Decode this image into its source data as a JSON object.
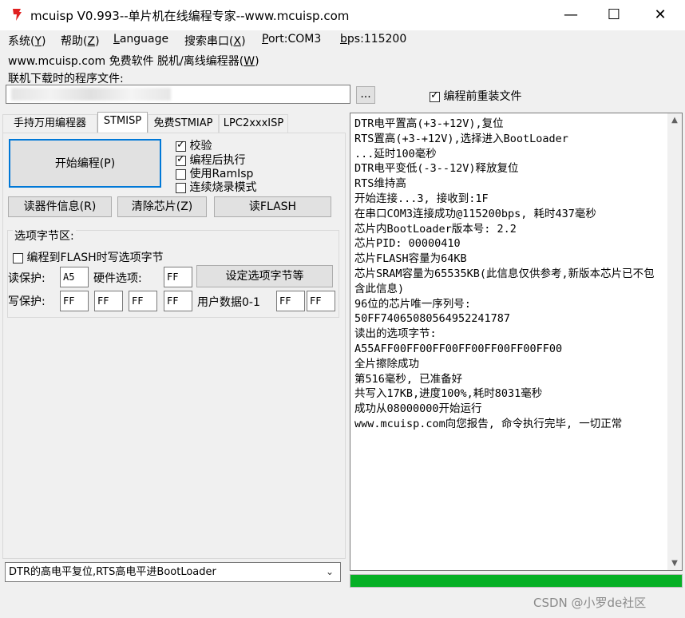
{
  "window": {
    "title": "mcuisp V0.993--单片机在线编程专家--www.mcuisp.com",
    "minimize": "—",
    "maximize": "☐",
    "close": "✕"
  },
  "menu": [
    {
      "text": "系统(",
      "key": "Y",
      "end": ")"
    },
    {
      "text": "帮助(",
      "key": "Z",
      "end": ")"
    },
    {
      "text": "",
      "key": "L",
      "end": "anguage"
    },
    {
      "text": "搜索串口(",
      "key": "X",
      "end": ")"
    },
    {
      "text": "",
      "key": "P",
      "end": "ort:COM3"
    },
    {
      "text": "",
      "key": "b",
      "end": "ps:115200"
    }
  ],
  "line2": {
    "text": "www.mcuisp.com 免费软件 脱机/离线编程器(",
    "key": "W",
    "end": ")"
  },
  "file": {
    "label": "联机下载时的程序文件:",
    "browse": "...",
    "reload_label": "编程前重装文件",
    "reload_checked": true
  },
  "tabs": [
    "手持万用编程器",
    "STMISP",
    "免费STMIAP",
    "LPC2xxxISP"
  ],
  "active_tab": 1,
  "stmisp": {
    "start_button": "开始编程(P)",
    "options": [
      {
        "label": "校验",
        "checked": true
      },
      {
        "label": "编程后执行",
        "checked": true
      },
      {
        "label": "使用RamIsp",
        "checked": false
      },
      {
        "label": "连续烧录模式",
        "checked": false
      }
    ],
    "read_info_button": "读器件信息(R)",
    "erase_button": "清除芯片(Z)",
    "read_flash_button": "读FLASH",
    "option_bytes": {
      "title": "选项字节区:",
      "write_when_flash_label": "编程到FLASH时写选项字节",
      "write_when_flash_checked": false,
      "read_protect_label": "读保护:",
      "read_protect_value": "A5",
      "hw_option_label": "硬件选项:",
      "hw_option_value": "FF",
      "set_button": "设定选项字节等",
      "write_protect_label": "写保护:",
      "write_protect_values": [
        "FF",
        "FF",
        "FF",
        "FF"
      ],
      "user_data_label": "用户数据0-1",
      "user_data_values": [
        "FF",
        "FF"
      ]
    }
  },
  "boot_mode_select": "DTR的高电平复位,RTS高电平进BootLoader",
  "log": "DTR电平置高(+3-+12V),复位\nRTS置高(+3-+12V),选择进入BootLoader\n...延时100毫秒\nDTR电平变低(-3--12V)释放复位\nRTS维持高\n开始连接...3, 接收到:1F\n在串口COM3连接成功@115200bps, 耗时437毫秒\n芯片内BootLoader版本号: 2.2\n芯片PID: 00000410\n芯片FLASH容量为64KB\n芯片SRAM容量为65535KB(此信息仅供参考,新版本芯片已不包含此信息)\n96位的芯片唯一序列号:\n50FF74065080564952241787\n读出的选项字节:\nA55AFF00FF00FF00FF00FF00FF00FF00\n全片擦除成功\n第516毫秒, 已准备好\n共写入17KB,进度100%,耗时8031毫秒\n成功从08000000开始运行\nwww.mcuisp.com向您报告, 命令执行完毕, 一切正常",
  "progress_percent": 100,
  "watermark": "CSDN @小罗de社区",
  "colors": {
    "progress": "#06b025",
    "focus": "#0078d7",
    "icon": "#e02020"
  }
}
